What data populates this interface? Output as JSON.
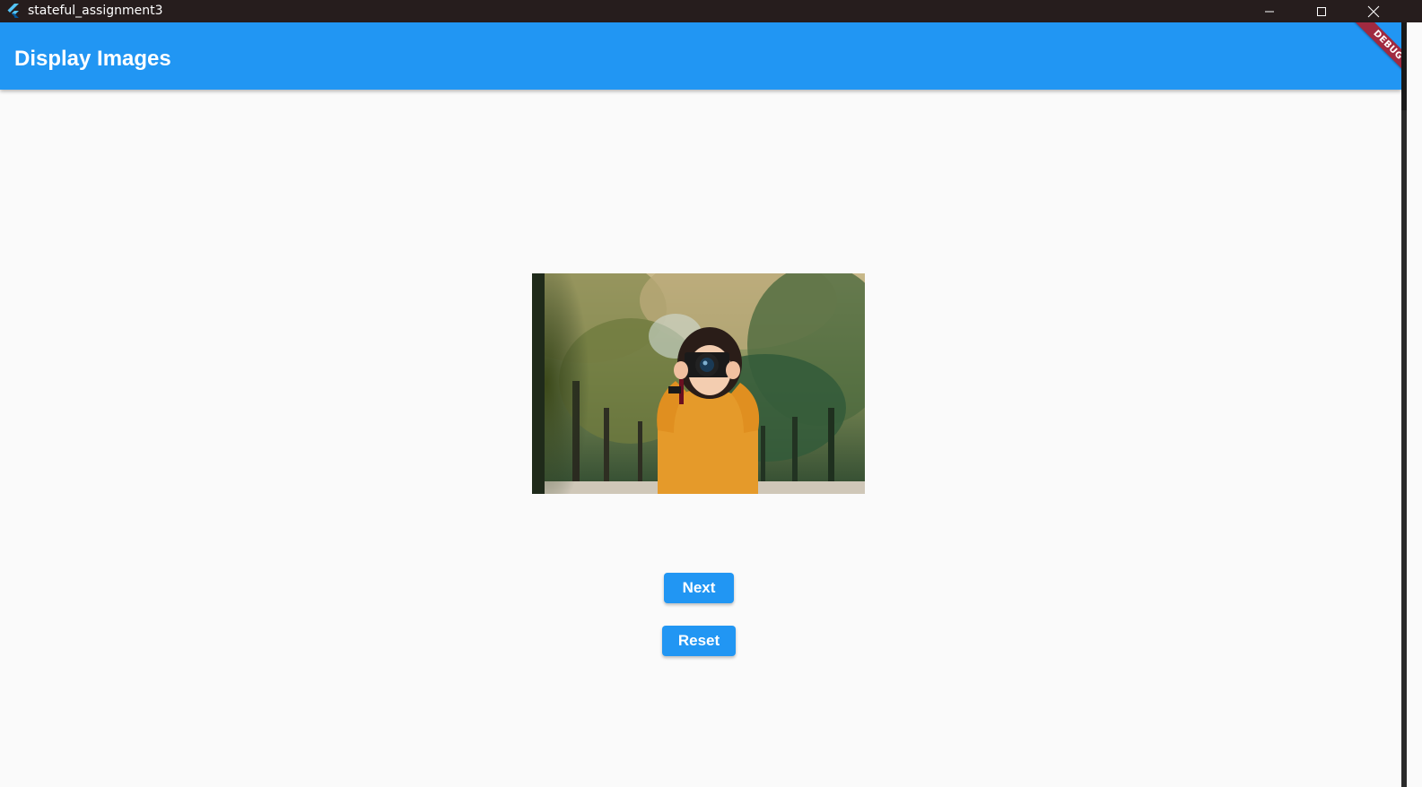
{
  "window": {
    "title": "stateful_assignment3",
    "controls": {
      "minimize_icon": "minimize-icon",
      "maximize_icon": "maximize-icon",
      "close_icon": "close-icon"
    }
  },
  "appbar": {
    "title": "Display Images",
    "color": "#2196f3"
  },
  "debug_banner": {
    "label": "DEBUG"
  },
  "content": {
    "image_icon": "photo-of-woman-with-camera",
    "buttons": {
      "next_label": "Next",
      "reset_label": "Reset"
    }
  },
  "colors": {
    "titlebar": "#261d1d",
    "accent": "#2196f3",
    "background": "#fafafa",
    "debug_ribbon": "#a02a40"
  }
}
